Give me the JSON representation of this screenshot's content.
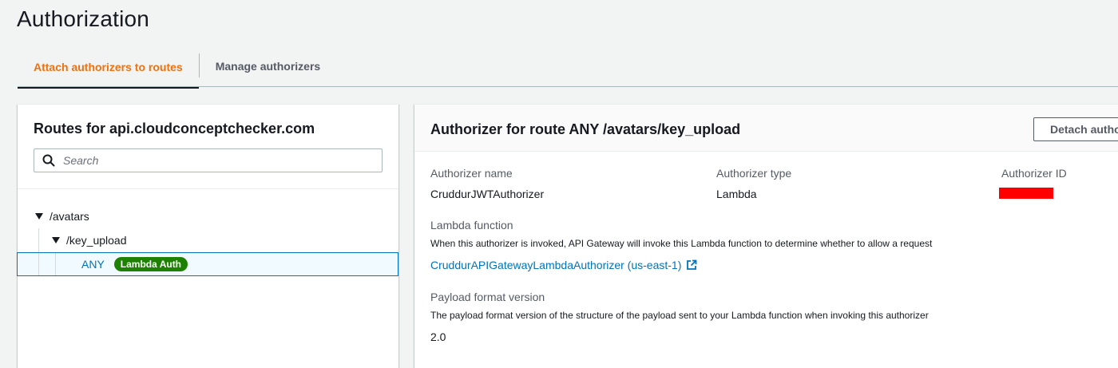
{
  "page": {
    "title": "Authorization"
  },
  "tabs": [
    {
      "label": "Attach authorizers to routes",
      "active": true
    },
    {
      "label": "Manage authorizers",
      "active": false
    }
  ],
  "routes": {
    "title": "Routes for api.cloudconceptchecker.com",
    "search_placeholder": "Search",
    "tree": {
      "root": "/avatars",
      "child": "/key_upload",
      "method": "ANY",
      "badge": "Lambda Auth"
    }
  },
  "authorizer": {
    "title": "Authorizer for route ANY /avatars/key_upload",
    "detach_label": "Detach authorizer",
    "name_label": "Authorizer name",
    "name_value": "CruddurJWTAuthorizer",
    "type_label": "Authorizer type",
    "type_value": "Lambda",
    "id_label": "Authorizer ID",
    "lambda_label": "Lambda function",
    "lambda_desc": "When this authorizer is invoked, API Gateway will invoke this Lambda function to determine whether to allow a request",
    "lambda_link": "CruddurAPIGatewayLambdaAuthorizer (us-east-1)",
    "payload_label": "Payload format version",
    "payload_desc": "The payload format version of the structure of the payload sent to your Lambda function when invoking this authorizer",
    "payload_value": "2.0"
  },
  "colors": {
    "accent": "#ec7211",
    "link": "#0073bb",
    "badge": "#1d8102",
    "redaction": "#ff0000"
  }
}
